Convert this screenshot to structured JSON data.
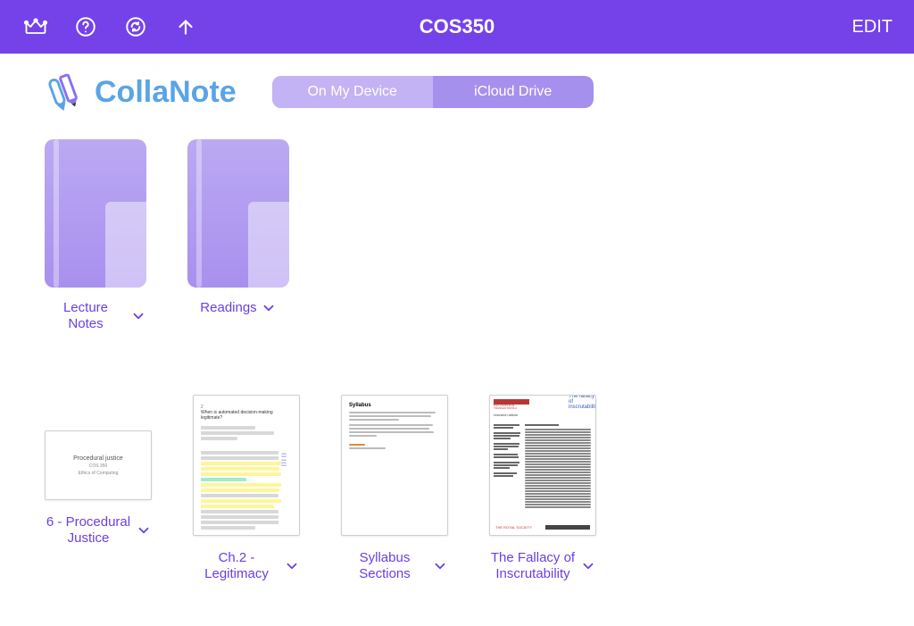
{
  "topbar": {
    "title": "COS350",
    "edit_label": "EDIT"
  },
  "brand": {
    "name": "CollaNote"
  },
  "segmented": {
    "options": [
      "On My Device",
      "iCloud Drive"
    ],
    "selected_index": 0
  },
  "folders": [
    {
      "name": "Lecture Notes"
    },
    {
      "name": "Readings"
    }
  ],
  "documents": [
    {
      "name": "6 - Procedural Justice",
      "thumb": {
        "kind": "slide",
        "title": "Procedural justice",
        "subtitle_lines": [
          "COS 350",
          "Ethics of Computing"
        ]
      }
    },
    {
      "name": "Ch.2 - Legitimacy",
      "thumb": {
        "kind": "highlighted_page",
        "heading": "When is automated decision-making legitimate?"
      }
    },
    {
      "name": "Syllabus Sections",
      "thumb": {
        "kind": "syllabus",
        "title": "Syllabus"
      }
    },
    {
      "name": "The Fallacy of Inscrutability",
      "thumb": {
        "kind": "journal",
        "journal_label": "PHILOSOPHICAL TRANSACTIONS A",
        "title": "The fallacy of inscrutability",
        "footer": "THE ROYAL SOCIETY"
      }
    }
  ],
  "colors": {
    "topbar": "#7442e8",
    "accent_text": "#6b3fe4",
    "segment_bg": "#a690ee",
    "segment_selected": "#c3b3f4",
    "logo_blue": "#5aa4e6"
  }
}
